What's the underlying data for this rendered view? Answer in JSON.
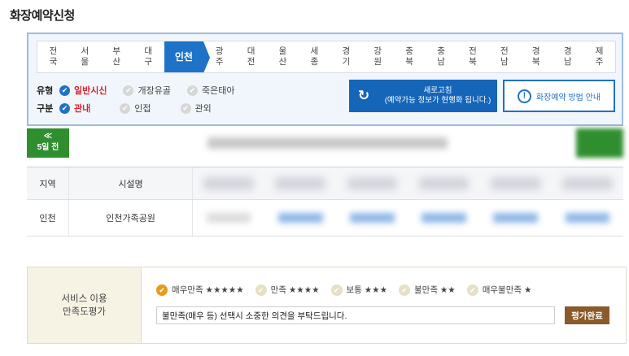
{
  "page": {
    "title": "화장예약신청"
  },
  "regions": [
    {
      "label": "전\n국",
      "active": false
    },
    {
      "label": "서\n울",
      "active": false
    },
    {
      "label": "부\n산",
      "active": false
    },
    {
      "label": "대\n구",
      "active": false
    },
    {
      "label": "인천",
      "active": true
    },
    {
      "label": "광\n주",
      "active": false
    },
    {
      "label": "대\n전",
      "active": false
    },
    {
      "label": "울\n산",
      "active": false
    },
    {
      "label": "세\n종",
      "active": false
    },
    {
      "label": "경\n기",
      "active": false
    },
    {
      "label": "강\n원",
      "active": false
    },
    {
      "label": "충\n북",
      "active": false
    },
    {
      "label": "충\n남",
      "active": false
    },
    {
      "label": "전\n북",
      "active": false
    },
    {
      "label": "전\n남",
      "active": false
    },
    {
      "label": "경\n북",
      "active": false
    },
    {
      "label": "경\n남",
      "active": false
    },
    {
      "label": "제\n주",
      "active": false
    }
  ],
  "filters": {
    "type_label": "유형",
    "type_options": [
      {
        "label": "일반시신",
        "checked": true
      },
      {
        "label": "개장유골",
        "checked": false
      },
      {
        "label": "죽은태아",
        "checked": false
      }
    ],
    "scope_label": "구분",
    "scope_options": [
      {
        "label": "관내",
        "checked": true
      },
      {
        "label": "인접",
        "checked": false
      },
      {
        "label": "관외",
        "checked": false
      }
    ]
  },
  "buttons": {
    "refresh_title": "새로고침",
    "refresh_sub": "(예약가능 정보가 현행화 됩니다.)",
    "guide": "화장예약 방법 안내",
    "prev_arrow": "≪",
    "prev_label": "5일 전"
  },
  "table": {
    "headers": {
      "region": "지역",
      "facility": "시설명"
    },
    "rows": [
      {
        "region": "인천",
        "facility": "인천가족공원"
      }
    ]
  },
  "evaluation": {
    "label": "서비스 이용\n만족도평가",
    "options": [
      {
        "label": "매우만족 ★★★★★",
        "checked": true
      },
      {
        "label": "만족 ★★★★",
        "checked": false
      },
      {
        "label": "보통 ★★★",
        "checked": false
      },
      {
        "label": "불만족 ★★",
        "checked": false
      },
      {
        "label": "매우불만족 ★",
        "checked": false
      }
    ],
    "opinion_value": "불만족(매우 등) 선택시 소중한 의견을 부탁드립니다.",
    "submit": "평가완료"
  },
  "colors": {
    "accent": "#1e72c8",
    "selected": "#d6262f",
    "nav_green": "#2f8f2f",
    "eval_accent": "#e89a1d",
    "submit_brown": "#8a5a2a"
  }
}
